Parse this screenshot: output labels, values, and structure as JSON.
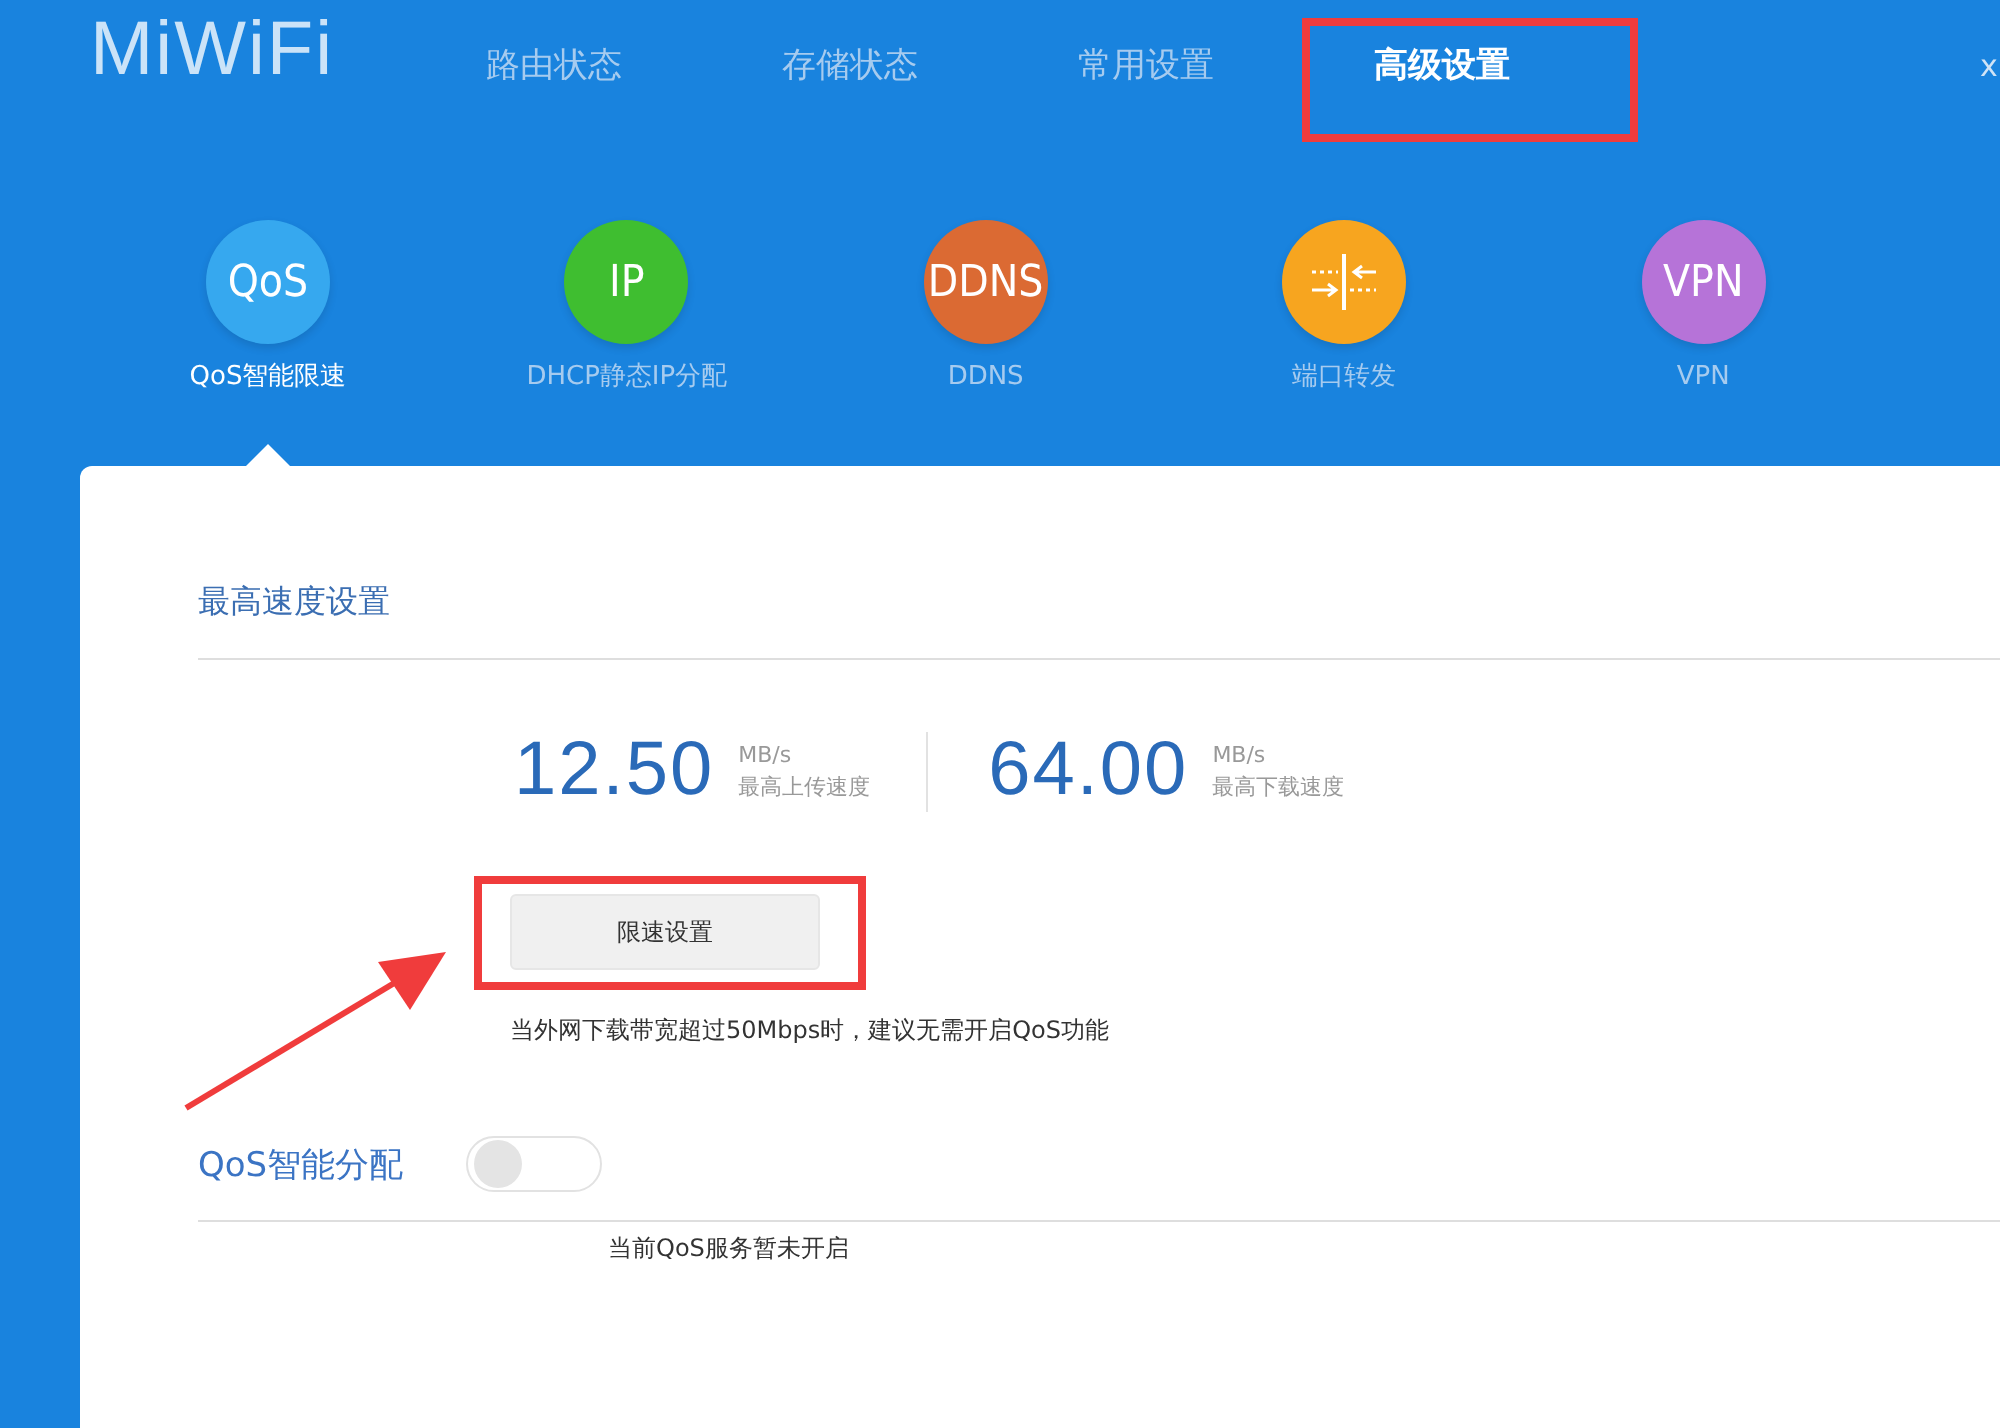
{
  "header": {
    "logo": "MiWiFi",
    "tabs": [
      {
        "label": "路由状态",
        "selected": false,
        "highlighted": false
      },
      {
        "label": "存储状态",
        "selected": false,
        "highlighted": false
      },
      {
        "label": "常用设置",
        "selected": false,
        "highlighted": false
      },
      {
        "label": "高级设置",
        "selected": true,
        "highlighted": true
      }
    ],
    "close_label": "x"
  },
  "features": [
    {
      "kind": "text",
      "badge": "QoS",
      "label": "QoS智能限速",
      "color": "#36a8ef",
      "selected": true
    },
    {
      "kind": "text",
      "badge": "IP",
      "label": "DHCP静态IP分配",
      "color": "#3fbe30",
      "selected": false
    },
    {
      "kind": "text",
      "badge": "DDNS",
      "label": "DDNS",
      "color": "#db6a33",
      "selected": false
    },
    {
      "kind": "icon",
      "label": "端口转发",
      "color": "#f7a51f",
      "selected": false
    },
    {
      "kind": "text",
      "badge": "VPN",
      "label": "VPN",
      "color": "#b673d8",
      "selected": false
    }
  ],
  "speed_section": {
    "title": "最高速度设置",
    "stats": [
      {
        "value": "12.50",
        "unit": "MB/s",
        "caption": "最高上传速度"
      },
      {
        "value": "64.00",
        "unit": "MB/s",
        "caption": "最高下载速度"
      }
    ],
    "button": {
      "label": "限速设置",
      "highlighted": true
    },
    "hint": "当外网下载带宽超过50Mbps时，建议无需开启QoS功能"
  },
  "qos_section": {
    "label": "QoS智能分配",
    "on": false,
    "status": "当前QoS服务暂未开启"
  }
}
